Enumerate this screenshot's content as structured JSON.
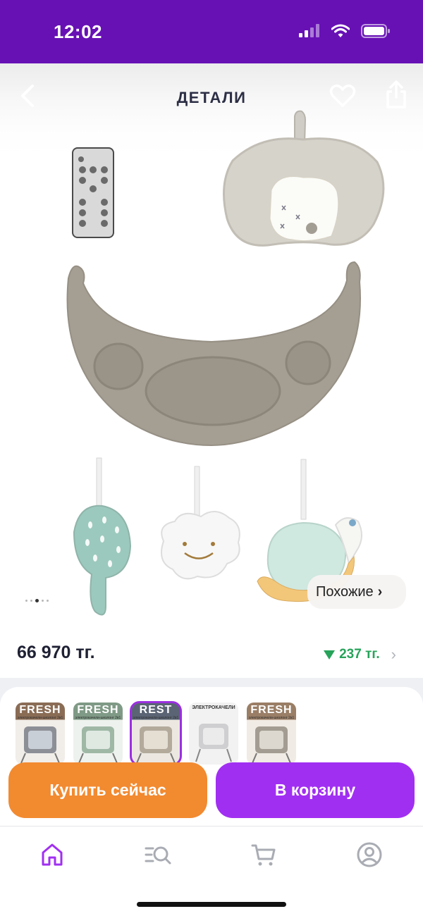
{
  "status_bar": {
    "time": "12:02"
  },
  "header": {
    "title": "ДЕТАЛИ"
  },
  "gallery": {
    "similar_label": "Похожие",
    "pages": 4,
    "active_page": 3
  },
  "price": {
    "amount": "66 970 тг.",
    "change": "237 тг.",
    "change_direction": "down",
    "change_color": "#27a35a"
  },
  "variants": [
    {
      "brand": "FRESH",
      "caption": "электрокачели-шезлонг 2в1",
      "selected": false
    },
    {
      "brand": "FRESH",
      "caption": "электрокачели-шезлонг 2в1",
      "selected": false
    },
    {
      "brand": "REST",
      "caption": "электрокачели-шезлонг 2в1",
      "selected": true
    },
    {
      "brand": "",
      "caption": "ЭЛЕКТРОКАЧЕЛИ",
      "selected": false
    },
    {
      "brand": "FRESH",
      "caption": "электрокачели-шезлонг 2в1",
      "selected": false
    }
  ],
  "actions": {
    "buy_now": "Купить сейчас",
    "add_to_cart": "В корзину"
  },
  "nav": {
    "items": [
      {
        "icon": "home-icon",
        "active": true
      },
      {
        "icon": "catalog-search-icon",
        "active": false
      },
      {
        "icon": "cart-icon",
        "active": false
      },
      {
        "icon": "profile-icon",
        "active": false
      }
    ]
  },
  "colors": {
    "brand_purple": "#6711b5",
    "buy_orange": "#f28a30",
    "cart_purple": "#a12ff2",
    "active_nav": "#a12ff2"
  }
}
